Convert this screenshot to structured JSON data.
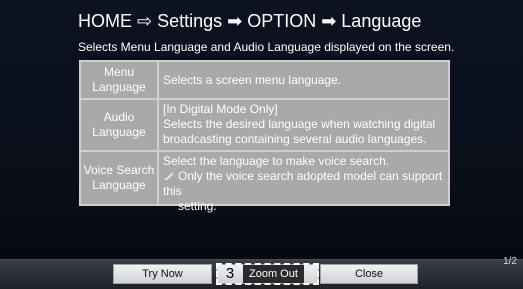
{
  "header": {
    "title": "HOME ⇨ Settings ➡ OPTION ➡ Language",
    "subtitle": "Selects Menu Language and Audio Language displayed on the screen."
  },
  "table": {
    "rows": [
      {
        "label_lines": [
          "Menu",
          "Language"
        ],
        "desc_lines": [
          "Selects a screen menu language."
        ]
      },
      {
        "label_lines": [
          "Audio",
          "Language"
        ],
        "desc_lines": [
          "[In Digital Mode Only]",
          "Selects the desired language when watching digital",
          "broadcasting containing several audio languages."
        ]
      },
      {
        "label_lines": [
          "Voice Search",
          "Language"
        ],
        "desc_lines": [
          "Select the language to make voice search.",
          "Only the voice search adopted model can support this",
          "setting."
        ]
      }
    ]
  },
  "bottom": {
    "buttons": {
      "try_now": "Try Now",
      "zoom_number": "3",
      "zoom_out": "Zoom Out",
      "close": "Close"
    },
    "page_indicator": "1/2"
  },
  "icons": {
    "scroll_down": "chevron-down-icon",
    "note": "pencil-icon"
  },
  "colors": {
    "background": "#0a0f1a",
    "table_fill": "#a9a9a9",
    "table_border": "#cfcfcf",
    "text": "#ffffff"
  }
}
